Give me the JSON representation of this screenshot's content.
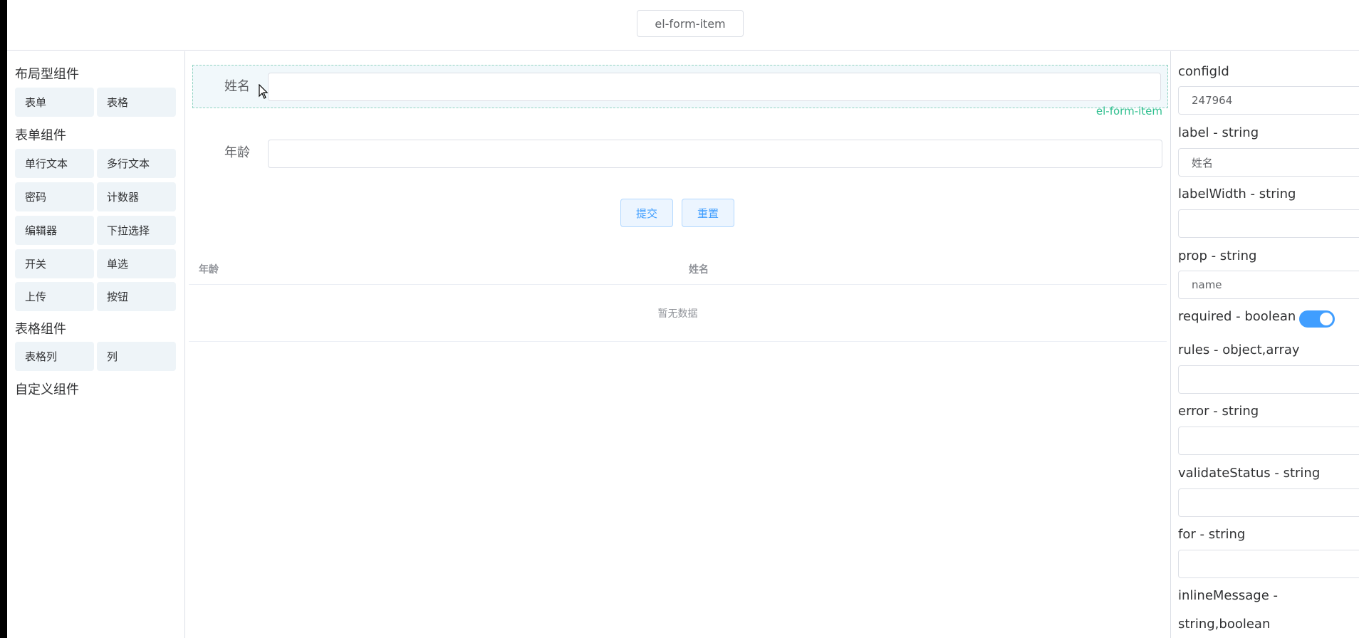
{
  "header": {
    "component_tag": "el-form-item"
  },
  "sidebar": {
    "groups": [
      {
        "title": "布局型组件",
        "items": [
          "表单",
          "表格"
        ]
      },
      {
        "title": "表单组件",
        "items": [
          "单行文本",
          "多行文本",
          "密码",
          "计数器",
          "编辑器",
          "下拉选择",
          "开关",
          "单选",
          "上传",
          "按钮"
        ]
      },
      {
        "title": "表格组件",
        "items": [
          "表格列",
          "列"
        ]
      },
      {
        "title": "自定义组件",
        "items": []
      }
    ]
  },
  "canvas": {
    "selected_tag": "el-form-item",
    "fields": [
      {
        "label": "姓名",
        "value": ""
      },
      {
        "label": "年龄",
        "value": ""
      }
    ],
    "submit_label": "提交",
    "reset_label": "重置",
    "table": {
      "columns": [
        "年龄",
        "姓名"
      ],
      "empty_text": "暂无数据"
    }
  },
  "properties": {
    "configId": {
      "label": "configId",
      "value": "247964"
    },
    "label": {
      "label": "label - string",
      "value": "姓名"
    },
    "labelWidth": {
      "label": "labelWidth - string",
      "value": ""
    },
    "prop": {
      "label": "prop - string",
      "value": "name"
    },
    "required": {
      "label": "required - boolean",
      "on": true
    },
    "rules": {
      "label": "rules - object,array",
      "value": ""
    },
    "error": {
      "label": "error - string",
      "value": ""
    },
    "validateStatus": {
      "label": "validateStatus - string",
      "value": ""
    },
    "for": {
      "label": "for - string",
      "value": ""
    },
    "inlineMessage": {
      "label_line1": "inlineMessage -",
      "label_line2": "string,boolean"
    }
  },
  "colors": {
    "accent": "#409eff",
    "tag_green": "#2fbf8f"
  }
}
